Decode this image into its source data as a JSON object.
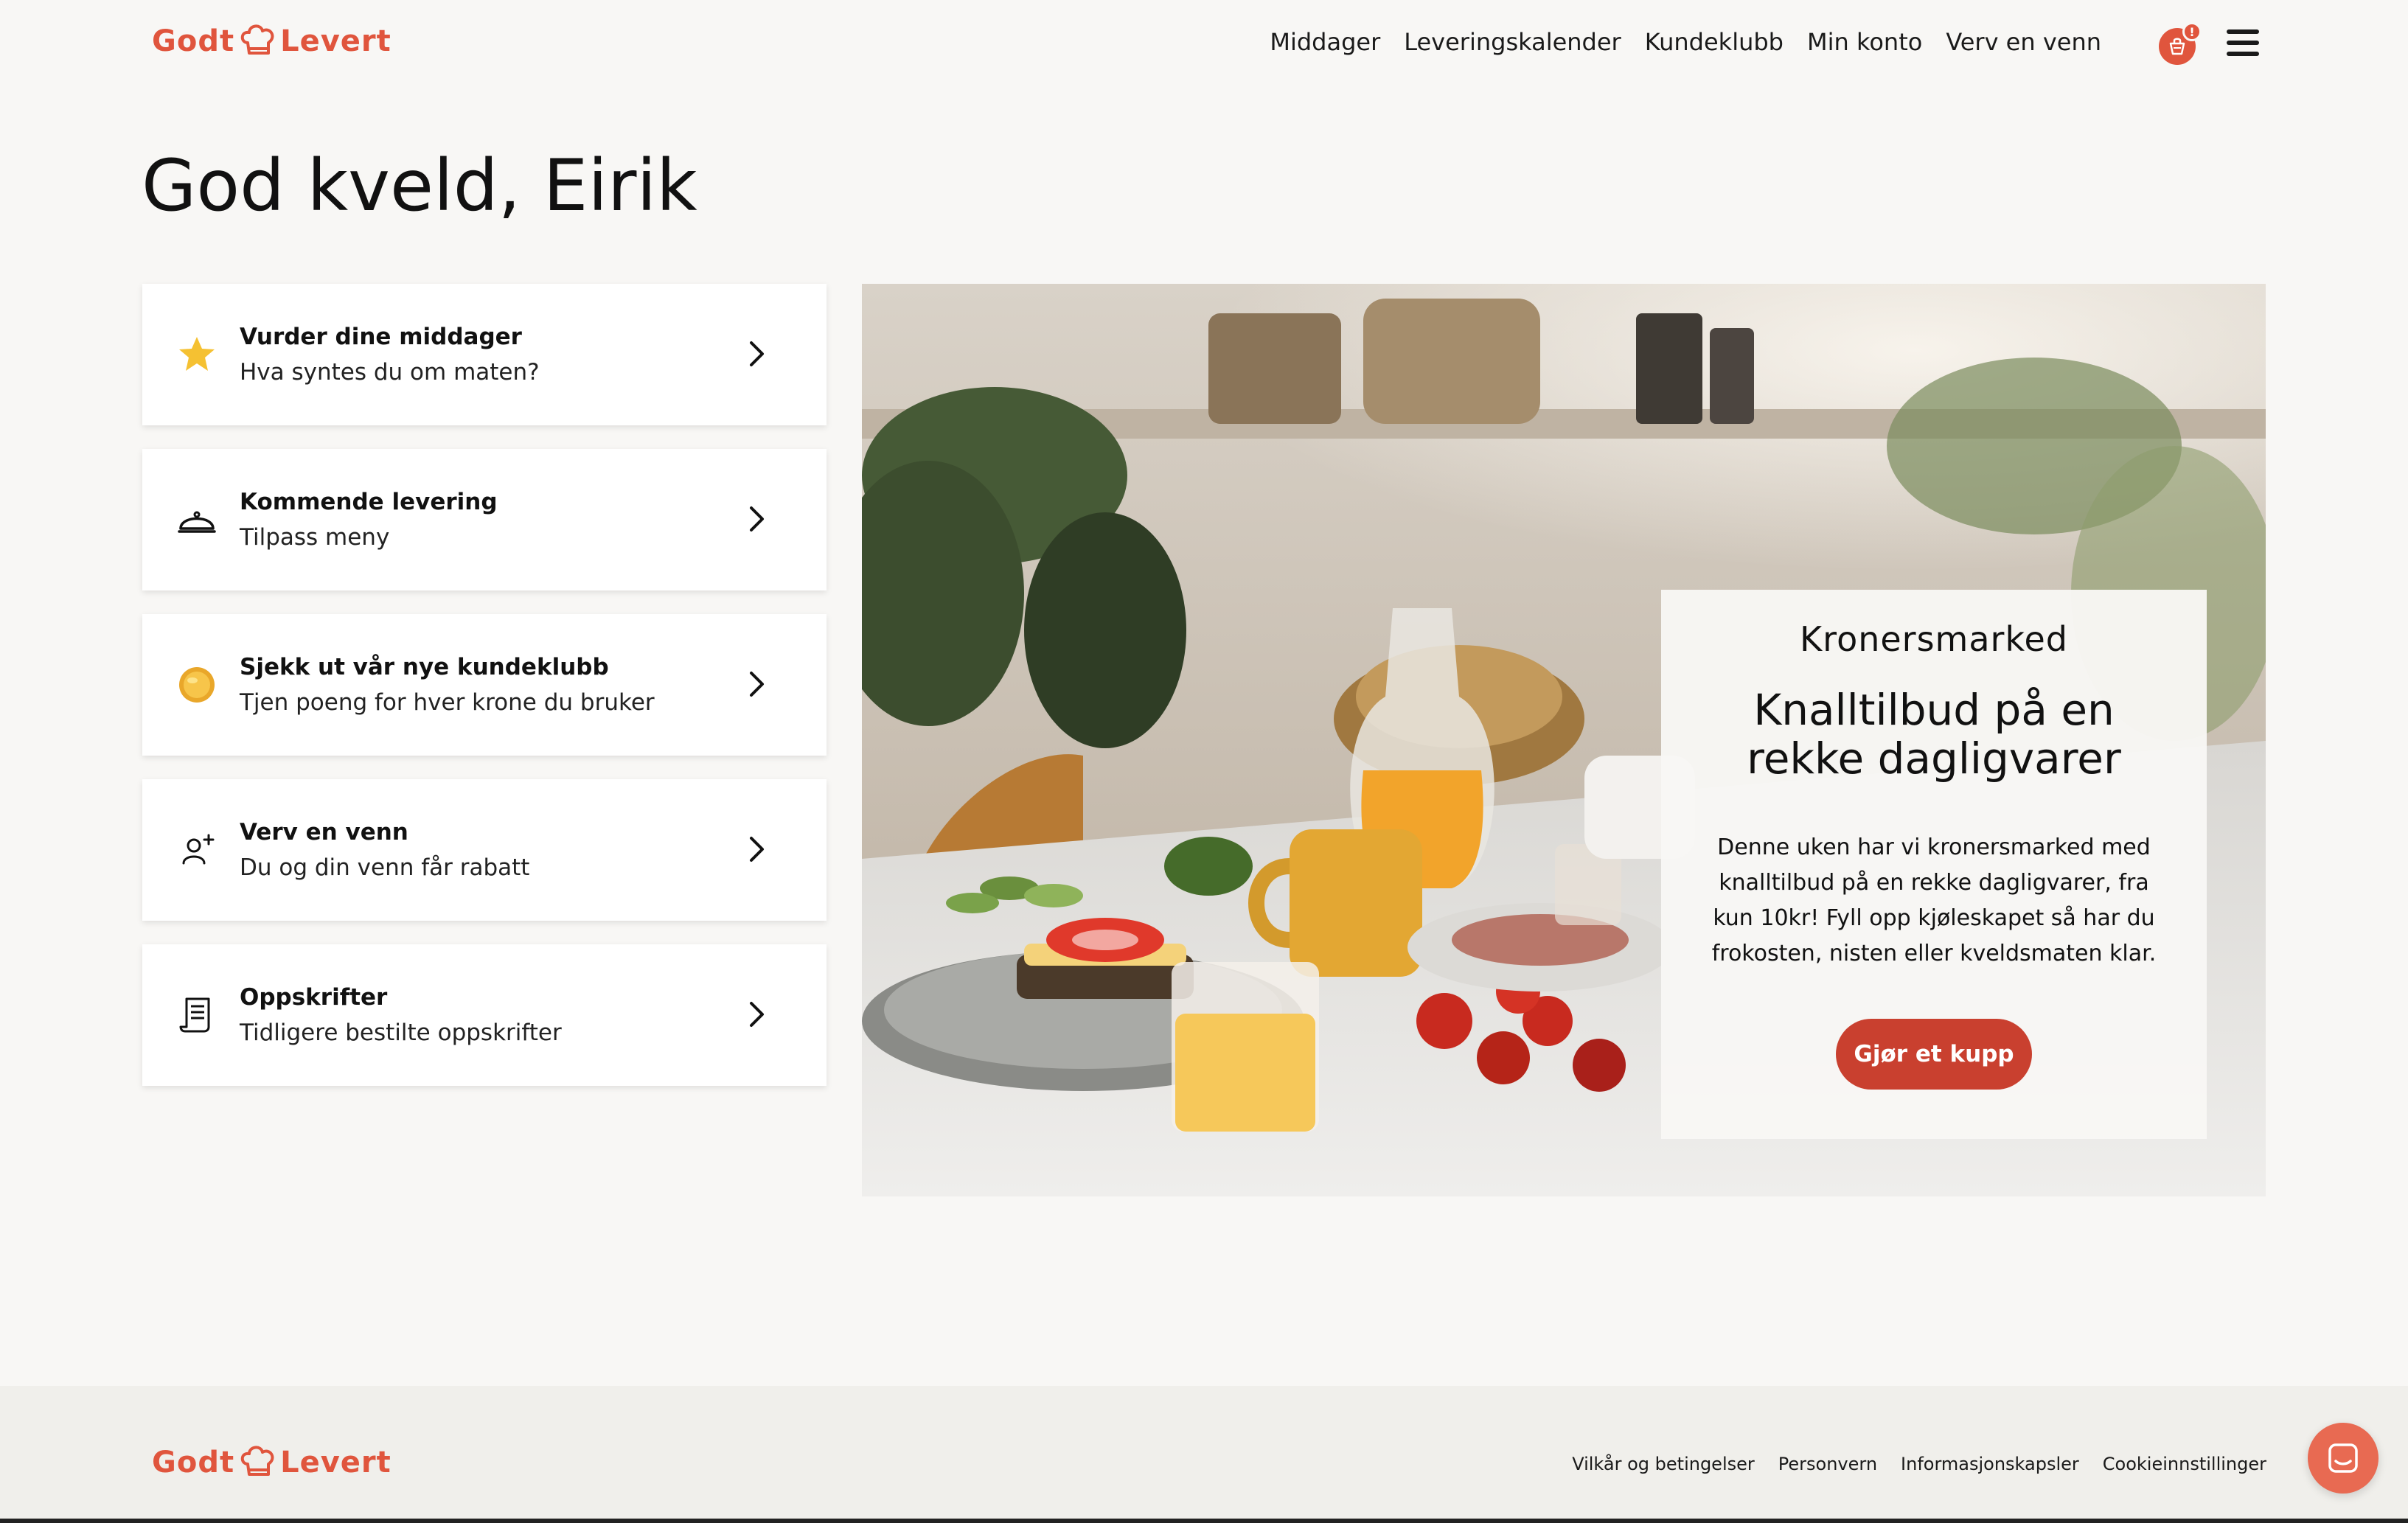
{
  "brand": {
    "name_left": "Godt",
    "name_right": "Levert",
    "color": "#e0553d"
  },
  "nav": {
    "items": [
      "Middager",
      "Leveringskalender",
      "Kundeklubb",
      "Min konto",
      "Verv en venn"
    ],
    "cart_icon": "basket-icon",
    "cart_badge": "!",
    "menu_icon": "hamburger-menu-icon"
  },
  "greeting": "God kveld, Eirik",
  "cards": [
    {
      "title": "Vurder dine middager",
      "subtitle": "Hva syntes du om maten?",
      "icon": "star-icon"
    },
    {
      "title": "Kommende levering",
      "subtitle": "Tilpass meny",
      "icon": "cloche-icon"
    },
    {
      "title": "Sjekk ut vår nye kundeklubb",
      "subtitle": "Tjen poeng for hver krone du bruker",
      "icon": "coin-icon"
    },
    {
      "title": "Verv en venn",
      "subtitle": "Du og din venn får rabatt",
      "icon": "add-user-icon"
    },
    {
      "title": "Oppskrifter",
      "subtitle": "Tidligere bestilte oppskrifter",
      "icon": "recipe-icon"
    }
  ],
  "promo": {
    "eyebrow": "Kronersmarked",
    "title": "Knalltilbud på en rekke dagligvarer",
    "body": "Denne uken har vi kronersmarked med knalltilbud på en rekke dagligvarer, fra kun 10kr! Fyll opp kjøleskapet så har du frokosten, nisten eller kveldsmaten klar.",
    "button": "Gjør et kupp",
    "button_color": "#c9402f"
  },
  "footer": {
    "links": [
      "Vilkår og betingelser",
      "Personvern",
      "Informasjonskapsler",
      "Cookieinnstillinger"
    ]
  },
  "chat": {
    "icon": "chat-icon",
    "color": "#e86a52"
  }
}
